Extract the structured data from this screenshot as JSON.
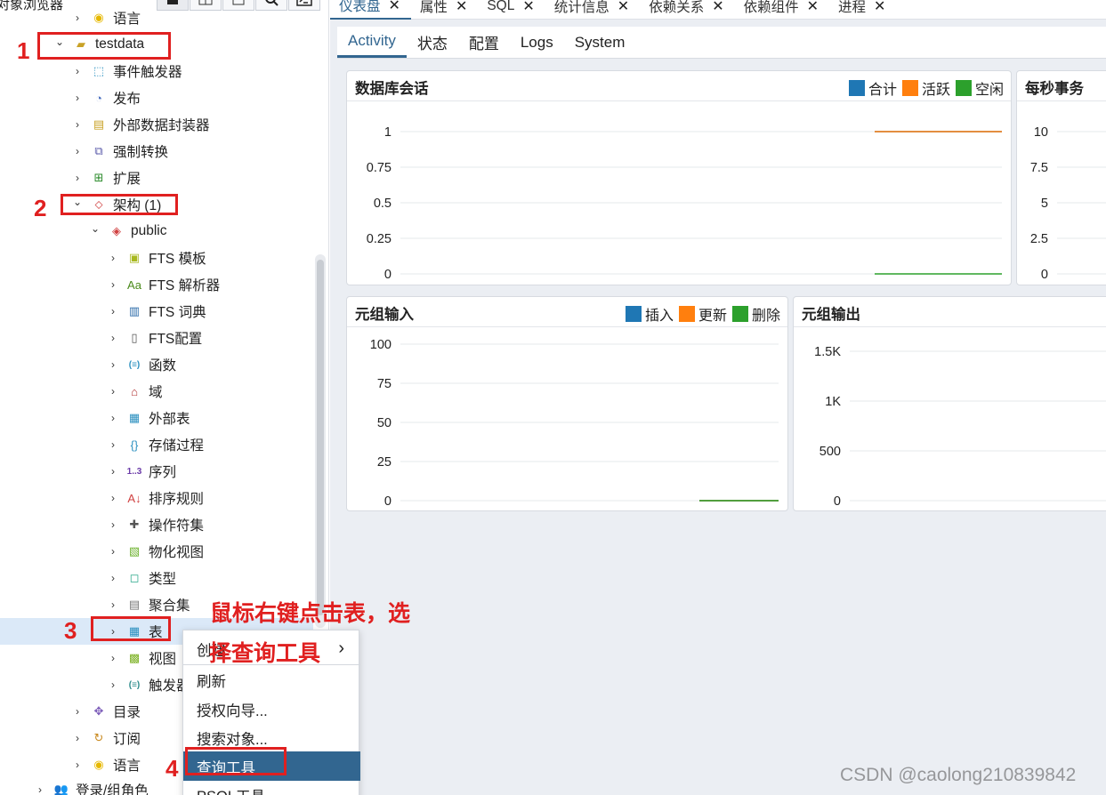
{
  "sidebar": {
    "title": "对象浏览器",
    "top_partial_label": "语言",
    "bottom_partial_label": "登录/组角色",
    "tree": [
      {
        "label": "testdata",
        "icon": "database-icon",
        "expanded": true
      },
      {
        "label": "事件触发器",
        "icon": "event-trigger-icon"
      },
      {
        "label": "发布",
        "icon": "publication-icon"
      },
      {
        "label": "外部数据封装器",
        "icon": "foreign-data-wrapper-icon"
      },
      {
        "label": "强制转换",
        "icon": "cast-icon"
      },
      {
        "label": "扩展",
        "icon": "extension-icon"
      },
      {
        "label": "架构 (1)",
        "icon": "schemas-icon",
        "expanded": true
      },
      {
        "label": "public",
        "icon": "schema-icon",
        "expanded": true
      },
      {
        "label": "FTS 模板",
        "icon": "fts-template-icon"
      },
      {
        "label": "FTS 解析器",
        "icon": "fts-parser-icon"
      },
      {
        "label": "FTS 词典",
        "icon": "fts-dictionary-icon"
      },
      {
        "label": "FTS配置",
        "icon": "fts-config-icon"
      },
      {
        "label": "函数",
        "icon": "function-icon"
      },
      {
        "label": "域",
        "icon": "domain-icon"
      },
      {
        "label": "外部表",
        "icon": "foreign-table-icon"
      },
      {
        "label": "存储过程",
        "icon": "procedure-icon"
      },
      {
        "label": "序列",
        "icon": "sequence-icon"
      },
      {
        "label": "排序规则",
        "icon": "collation-icon"
      },
      {
        "label": "操作符集",
        "icon": "operator-icon"
      },
      {
        "label": "物化视图",
        "icon": "materialized-view-icon"
      },
      {
        "label": "类型",
        "icon": "type-icon"
      },
      {
        "label": "聚合集",
        "icon": "aggregate-icon"
      },
      {
        "label": "表",
        "icon": "table-icon",
        "selected": true
      },
      {
        "label": "视图",
        "icon": "view-icon"
      },
      {
        "label": "触发器",
        "icon": "trigger-function-icon"
      },
      {
        "label": "目录",
        "icon": "catalog-icon"
      },
      {
        "label": "订阅",
        "icon": "subscription-icon"
      },
      {
        "label": "语言",
        "icon": "language-icon"
      }
    ]
  },
  "annotations": {
    "n1": "1",
    "n2": "2",
    "n3": "3",
    "n4": "4",
    "instruction_line1": "鼠标右键点击表，选",
    "instruction_line2": "择查询工具"
  },
  "main_tabs": [
    {
      "label": "仪表盘",
      "active": true
    },
    {
      "label": "属性"
    },
    {
      "label": "SQL"
    },
    {
      "label": "统计信息"
    },
    {
      "label": "依赖关系"
    },
    {
      "label": "依赖组件"
    },
    {
      "label": "进程"
    }
  ],
  "sub_tabs": [
    {
      "label": "Activity",
      "active": true
    },
    {
      "label": "状态"
    },
    {
      "label": "配置"
    },
    {
      "label": "Logs"
    },
    {
      "label": "System"
    }
  ],
  "context_menu": {
    "items": [
      {
        "label": "创建",
        "has_submenu": true
      },
      {
        "label": "刷新"
      },
      {
        "label": "授权向导..."
      },
      {
        "label": "搜索对象..."
      },
      {
        "label": "查询工具",
        "highlighted": true
      },
      {
        "label": "PSQL工具"
      }
    ]
  },
  "watermark": "CSDN @caolong210839842",
  "colors": {
    "blue": "#1f77b4",
    "orange": "#ff7f0e",
    "green": "#2ca02c",
    "accent": "#326690",
    "annotation": "#e02020"
  },
  "chart_data": [
    {
      "type": "line",
      "title": "数据库会话",
      "yticks": [
        "1",
        "0.75",
        "0.5",
        "0.25",
        "0"
      ],
      "ylim": [
        0,
        1
      ],
      "series": [
        {
          "name": "合计",
          "color": "#1f77b4",
          "values": [
            1,
            1
          ]
        },
        {
          "name": "活跃",
          "color": "#ff7f0e",
          "values": [
            1,
            1
          ]
        },
        {
          "name": "空闲",
          "color": "#2ca02c",
          "values": [
            0,
            0
          ]
        }
      ]
    },
    {
      "type": "line",
      "title": "每秒事务",
      "yticks": [
        "10",
        "7.5",
        "5",
        "2.5",
        "0"
      ],
      "ylim": [
        0,
        10
      ],
      "series": []
    },
    {
      "type": "line",
      "title": "元组输入",
      "yticks": [
        "100",
        "75",
        "50",
        "25",
        "0"
      ],
      "ylim": [
        0,
        100
      ],
      "series": [
        {
          "name": "插入",
          "color": "#1f77b4",
          "values": [
            0,
            0
          ]
        },
        {
          "name": "更新",
          "color": "#ff7f0e",
          "values": [
            0,
            0
          ]
        },
        {
          "name": "删除",
          "color": "#2ca02c",
          "values": [
            0,
            0
          ]
        }
      ]
    },
    {
      "type": "line",
      "title": "元组输出",
      "yticks": [
        "1.5K",
        "1K",
        "500",
        "0"
      ],
      "ylim": [
        0,
        1750
      ],
      "series": []
    }
  ]
}
